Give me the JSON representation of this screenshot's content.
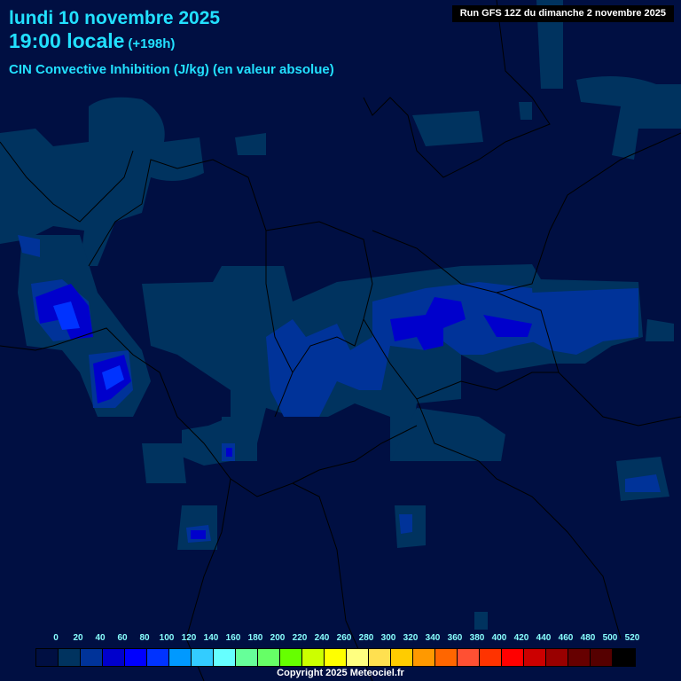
{
  "header": {
    "date": "lundi 10 novembre 2025",
    "time": "19:00 locale",
    "lead": "(+198h)",
    "parameter": "CIN Convective Inhibition (J/kg) (en valeur absolue)",
    "run": "Run GFS 12Z du dimanche 2 novembre 2025"
  },
  "legend": {
    "labels": [
      "0",
      "20",
      "40",
      "60",
      "80",
      "100",
      "120",
      "140",
      "160",
      "180",
      "200",
      "220",
      "240",
      "260",
      "280",
      "300",
      "320",
      "340",
      "360",
      "380",
      "400",
      "420",
      "440",
      "460",
      "480",
      "500",
      "520"
    ],
    "colors": [
      "#000f42",
      "#00335f",
      "#003399",
      "#0000cc",
      "#0000ff",
      "#0033ff",
      "#0099ff",
      "#33ccff",
      "#66ffff",
      "#66ff99",
      "#66ff66",
      "#66ff00",
      "#ccff00",
      "#ffff00",
      "#ffff80",
      "#ffe050",
      "#ffcc00",
      "#ff9900",
      "#ff6600",
      "#ff5033",
      "#ff3300",
      "#ff0000",
      "#cc0000",
      "#990000",
      "#660000",
      "#550000",
      "#000000"
    ]
  },
  "footer": {
    "copyright": "Copyright 2025 Meteociel.fr"
  }
}
